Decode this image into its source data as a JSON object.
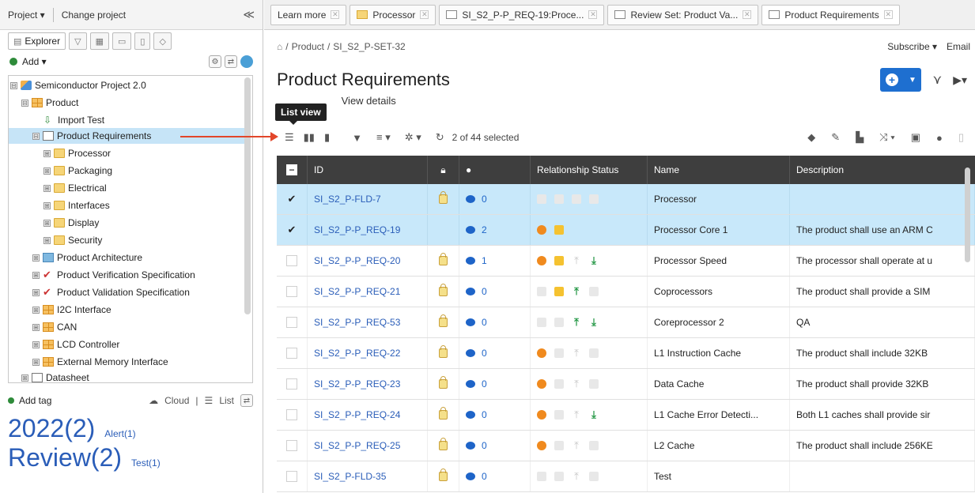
{
  "left": {
    "topbar": {
      "project_menu": "Project ▾",
      "change_project": "Change project",
      "collapse": "≪"
    },
    "tabs": [
      {
        "label": "Explorer"
      }
    ],
    "add_label": "Add ▾",
    "tree": [
      {
        "label": "Semiconductor Project 2.0",
        "icon": "people-icon",
        "expander": "⊟",
        "indent": 0
      },
      {
        "label": "Product",
        "icon": "grid-folder-icon",
        "expander": "⊟",
        "indent": 1
      },
      {
        "label": "Import Test",
        "icon": "import-icon",
        "expander": "",
        "indent": 2
      },
      {
        "label": "Product Requirements",
        "icon": "set-icon",
        "expander": "⊟",
        "indent": 2,
        "selected": true
      },
      {
        "label": "Processor",
        "icon": "folder-icon",
        "expander": "⊞",
        "indent": 3
      },
      {
        "label": "Packaging",
        "icon": "folder-icon",
        "expander": "⊞",
        "indent": 3
      },
      {
        "label": "Electrical",
        "icon": "folder-icon",
        "expander": "⊞",
        "indent": 3
      },
      {
        "label": "Interfaces",
        "icon": "folder-icon",
        "expander": "⊞",
        "indent": 3
      },
      {
        "label": "Display",
        "icon": "folder-icon",
        "expander": "⊞",
        "indent": 3
      },
      {
        "label": "Security",
        "icon": "folder-icon",
        "expander": "⊞",
        "indent": 3
      },
      {
        "label": "Product Architecture",
        "icon": "blue-doc-icon",
        "expander": "⊞",
        "indent": 2
      },
      {
        "label": "Product Verification Specification",
        "icon": "checkmark-icon",
        "expander": "⊞",
        "indent": 2
      },
      {
        "label": "Product Validation Specification",
        "icon": "checkmark-icon",
        "expander": "⊞",
        "indent": 2
      },
      {
        "label": "I2C Interface",
        "icon": "grid-folder-icon",
        "expander": "⊞",
        "indent": 2
      },
      {
        "label": "CAN",
        "icon": "grid-folder-icon",
        "expander": "⊞",
        "indent": 2
      },
      {
        "label": "LCD Controller",
        "icon": "grid-folder-icon",
        "expander": "⊞",
        "indent": 2
      },
      {
        "label": "External Memory Interface",
        "icon": "grid-folder-icon",
        "expander": "⊞",
        "indent": 2
      },
      {
        "label": "Datasheet",
        "icon": "doc-icon",
        "expander": "⊞",
        "indent": 1
      }
    ],
    "tagbar": {
      "add_tag": "Add tag",
      "cloud": "Cloud",
      "list": "List"
    },
    "tag_cloud": [
      {
        "big": "2022(2)",
        "small": "Alert(1)"
      },
      {
        "big": "Review(2)",
        "small": "Test(1)"
      }
    ]
  },
  "tabs": [
    {
      "label": "Learn more",
      "icon": "none"
    },
    {
      "label": "Processor",
      "icon": "folder"
    },
    {
      "label": "SI_S2_P-P_REQ-19:Proce...",
      "icon": "doc"
    },
    {
      "label": "Review Set: Product Va...",
      "icon": "doc"
    },
    {
      "label": "Product Requirements",
      "icon": "doc"
    }
  ],
  "breadcrumb": {
    "sep": "/",
    "product": "Product",
    "set": "SI_S2_P-SET-32"
  },
  "subscribe": "Subscribe ▾",
  "email": "Email",
  "page_title": "Product Requirements",
  "view_details": "View details",
  "tooltip": "List view",
  "toolbar": {
    "selected": "2 of 44 selected"
  },
  "table": {
    "headers": {
      "id": "ID",
      "relationship": "Relationship Status",
      "name": "Name",
      "description": "Description"
    },
    "rows": [
      {
        "id": "SI_S2_P-FLD-7",
        "lock": true,
        "comments": "0",
        "rel": [
          "dim",
          "dim",
          "dim",
          "dim"
        ],
        "name": "Processor",
        "description": "",
        "selected": true
      },
      {
        "id": "SI_S2_P-P_REQ-19",
        "lock": false,
        "comments": "2",
        "rel": [
          "orange",
          "yellow",
          "none",
          "none"
        ],
        "name": "Processor Core 1",
        "description": "The product shall use an ARM C",
        "selected": true
      },
      {
        "id": "SI_S2_P-P_REQ-20",
        "lock": true,
        "comments": "1",
        "rel": [
          "orange",
          "yellow",
          "dimup",
          "greendown"
        ],
        "name": "Processor Speed",
        "description": "The processor shall operate at u",
        "selected": false
      },
      {
        "id": "SI_S2_P-P_REQ-21",
        "lock": true,
        "comments": "0",
        "rel": [
          "dim",
          "yellow",
          "greenup",
          "dim"
        ],
        "name": "Coprocessors",
        "description": "The product shall provide a SIM",
        "selected": false
      },
      {
        "id": "SI_S2_P-P_REQ-53",
        "lock": true,
        "comments": "0",
        "rel": [
          "dim",
          "dim",
          "greenup",
          "greendown"
        ],
        "name": "Coreprocessor 2",
        "description": "QA",
        "selected": false
      },
      {
        "id": "SI_S2_P-P_REQ-22",
        "lock": true,
        "comments": "0",
        "rel": [
          "orange",
          "dim",
          "dimup",
          "dim"
        ],
        "name": "L1 Instruction Cache",
        "description": "The product shall include 32KB",
        "selected": false
      },
      {
        "id": "SI_S2_P-P_REQ-23",
        "lock": true,
        "comments": "0",
        "rel": [
          "orange",
          "dim",
          "dimup",
          "dim"
        ],
        "name": "Data Cache",
        "description": "The product shall provide 32KB",
        "selected": false
      },
      {
        "id": "SI_S2_P-P_REQ-24",
        "lock": true,
        "comments": "0",
        "rel": [
          "orange",
          "dim",
          "dimup",
          "greendown"
        ],
        "name": "L1 Cache Error Detecti...",
        "description": "Both L1 caches shall provide sir",
        "selected": false
      },
      {
        "id": "SI_S2_P-P_REQ-25",
        "lock": true,
        "comments": "0",
        "rel": [
          "orange",
          "dim",
          "dimup",
          "dim"
        ],
        "name": "L2 Cache",
        "description": "The product shall include 256KE",
        "selected": false
      },
      {
        "id": "SI_S2_P-FLD-35",
        "lock": true,
        "comments": "0",
        "rel": [
          "dim",
          "dim",
          "dimup",
          "dim"
        ],
        "name": "Test",
        "description": "",
        "selected": false
      }
    ]
  },
  "colors": {
    "accent": "#1e6fd0",
    "selection": "#c8e8fa",
    "arrow": "#e2462a",
    "header": "#3e3e3e"
  }
}
